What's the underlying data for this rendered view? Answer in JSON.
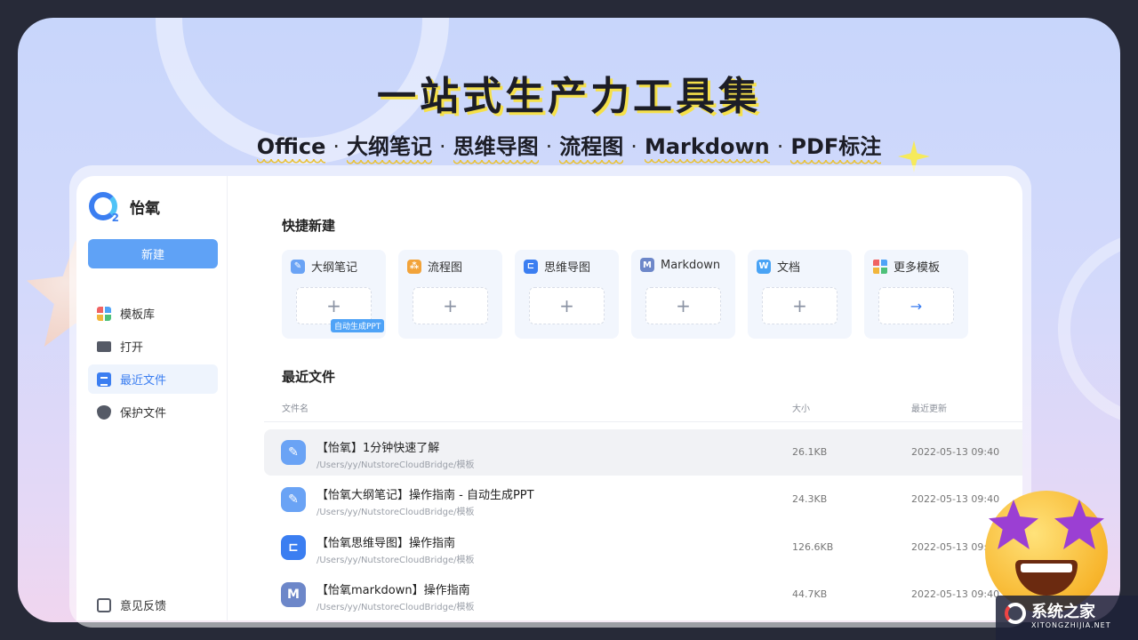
{
  "hero": {
    "title": "一站式生产力工具集",
    "features": [
      "Office",
      "大纲笔记",
      "思维导图",
      "流程图",
      "Markdown",
      "PDF标注"
    ],
    "separator": "·"
  },
  "app": {
    "logo_text": "怡氧",
    "logo_badge": "2",
    "new_button": "新建",
    "nav": [
      {
        "label": "模板库",
        "icon": "template-grid-icon"
      },
      {
        "label": "打开",
        "icon": "folder-icon"
      },
      {
        "label": "最近文件",
        "icon": "document-icon",
        "active": true
      },
      {
        "label": "保护文件",
        "icon": "shield-icon"
      }
    ],
    "feedback": "意见反馈",
    "quick_new": {
      "title": "快捷新建",
      "cards": [
        {
          "label": "大纲笔记",
          "icon": "outline-note-icon",
          "action": "+",
          "badge": "自动生成PPT"
        },
        {
          "label": "流程图",
          "icon": "flowchart-icon",
          "action": "+"
        },
        {
          "label": "思维导图",
          "icon": "mindmap-icon",
          "action": "+"
        },
        {
          "label": "Markdown",
          "icon": "markdown-icon",
          "icon_text": "M",
          "action": "+"
        },
        {
          "label": "文档",
          "icon": "word-doc-icon",
          "icon_text": "W",
          "action": "+"
        },
        {
          "label": "更多模板",
          "icon": "more-templates-icon",
          "action": "→"
        }
      ]
    },
    "recent": {
      "title": "最近文件",
      "columns": {
        "name": "文件名",
        "size": "大小",
        "updated": "最近更新"
      },
      "rows": [
        {
          "name": "【怡氧】1分钟快速了解",
          "path": "/Users/yy/NutstoreCloudBridge/模板",
          "size": "26.1KB",
          "updated": "2022-05-13 09:40",
          "icon": "outline-note-icon"
        },
        {
          "name": "【怡氧大纲笔记】操作指南 - 自动生成PPT",
          "path": "/Users/yy/NutstoreCloudBridge/模板",
          "size": "24.3KB",
          "updated": "2022-05-13 09:40",
          "icon": "outline-note-icon"
        },
        {
          "name": "【怡氧思维导图】操作指南",
          "path": "/Users/yy/NutstoreCloudBridge/模板",
          "size": "126.6KB",
          "updated": "2022-05-13 09:40",
          "icon": "mindmap-icon"
        },
        {
          "name": "【怡氧markdown】操作指南",
          "path": "/Users/yy/NutstoreCloudBridge/模板",
          "size": "44.7KB",
          "updated": "2022-05-13 09:40",
          "icon": "markdown-icon",
          "icon_text": "M"
        }
      ]
    }
  },
  "watermark": {
    "text": "系统之家",
    "sub": "XITONGZHIJIA.NET"
  },
  "colors": {
    "accent": "#3b7ef1",
    "button": "#5fa2f6",
    "highlight": "#f5e04a"
  }
}
